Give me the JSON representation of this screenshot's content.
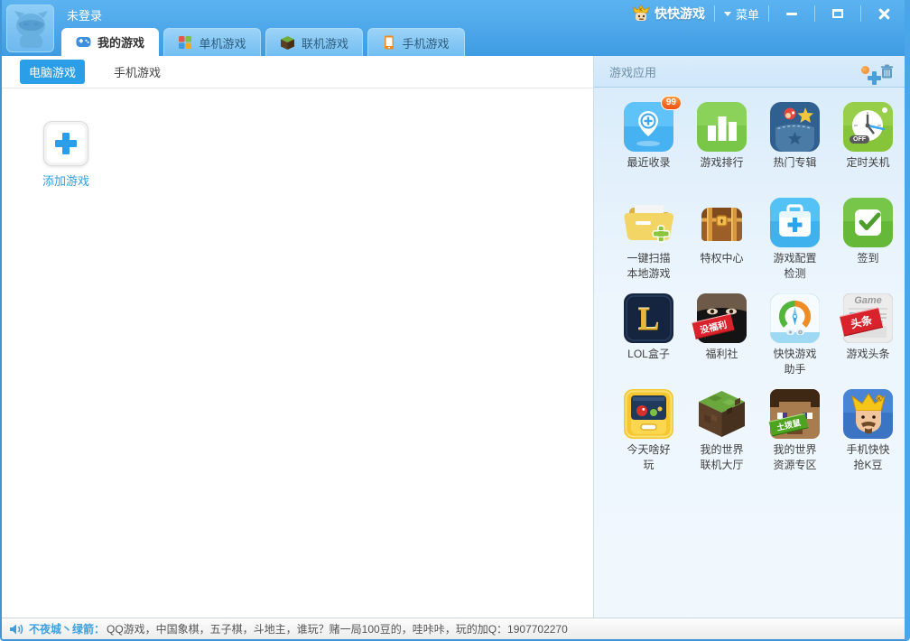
{
  "titlebar": {
    "login_status": "未登录",
    "brand": "快快游戏",
    "menu_label": "菜单"
  },
  "tabs": [
    {
      "label": "我的游戏",
      "active": true
    },
    {
      "label": "单机游戏",
      "active": false
    },
    {
      "label": "联机游戏",
      "active": false
    },
    {
      "label": "手机游戏",
      "active": false
    }
  ],
  "subtabs": [
    {
      "label": "电脑游戏",
      "active": true
    },
    {
      "label": "手机游戏",
      "active": false
    }
  ],
  "content": {
    "add_game_label": "添加游戏"
  },
  "apps_panel": {
    "title": "游戏应用",
    "apps": [
      {
        "label": "最近收录",
        "badge": "99"
      },
      {
        "label": "游戏排行"
      },
      {
        "label": "热门专辑"
      },
      {
        "label": "定时关机",
        "overlay": "OFF"
      },
      {
        "label": "一键扫描\n本地游戏"
      },
      {
        "label": "特权中心"
      },
      {
        "label": "游戏配置\n检测"
      },
      {
        "label": "签到"
      },
      {
        "label": "LOL盒子",
        "letter": "L"
      },
      {
        "label": "福利社",
        "overlay": "没福利"
      },
      {
        "label": "快快游戏\n助手"
      },
      {
        "label": "游戏头条",
        "overlay": "头条",
        "overlay_top": "Game"
      },
      {
        "label": "今天啥好\n玩"
      },
      {
        "label": "我的世界\n联机大厅"
      },
      {
        "label": "我的世界\n资源专区",
        "overlay": "土拨鼠"
      },
      {
        "label": "手机快快\n抢K豆"
      }
    ]
  },
  "statusbar": {
    "nickname": "不夜城丶绿箭：",
    "message": "QQ游戏，中国象棋，五子棋，斗地主，谁玩？赌一局100豆的，哇咔咔，玩的加Q：1907702270"
  },
  "colors": {
    "accent_blue": "#2b9ee8",
    "titlebar_blue": "#4aa5e9",
    "badge_red": "#f04e13",
    "panel_bg": "#d7ebfa"
  }
}
